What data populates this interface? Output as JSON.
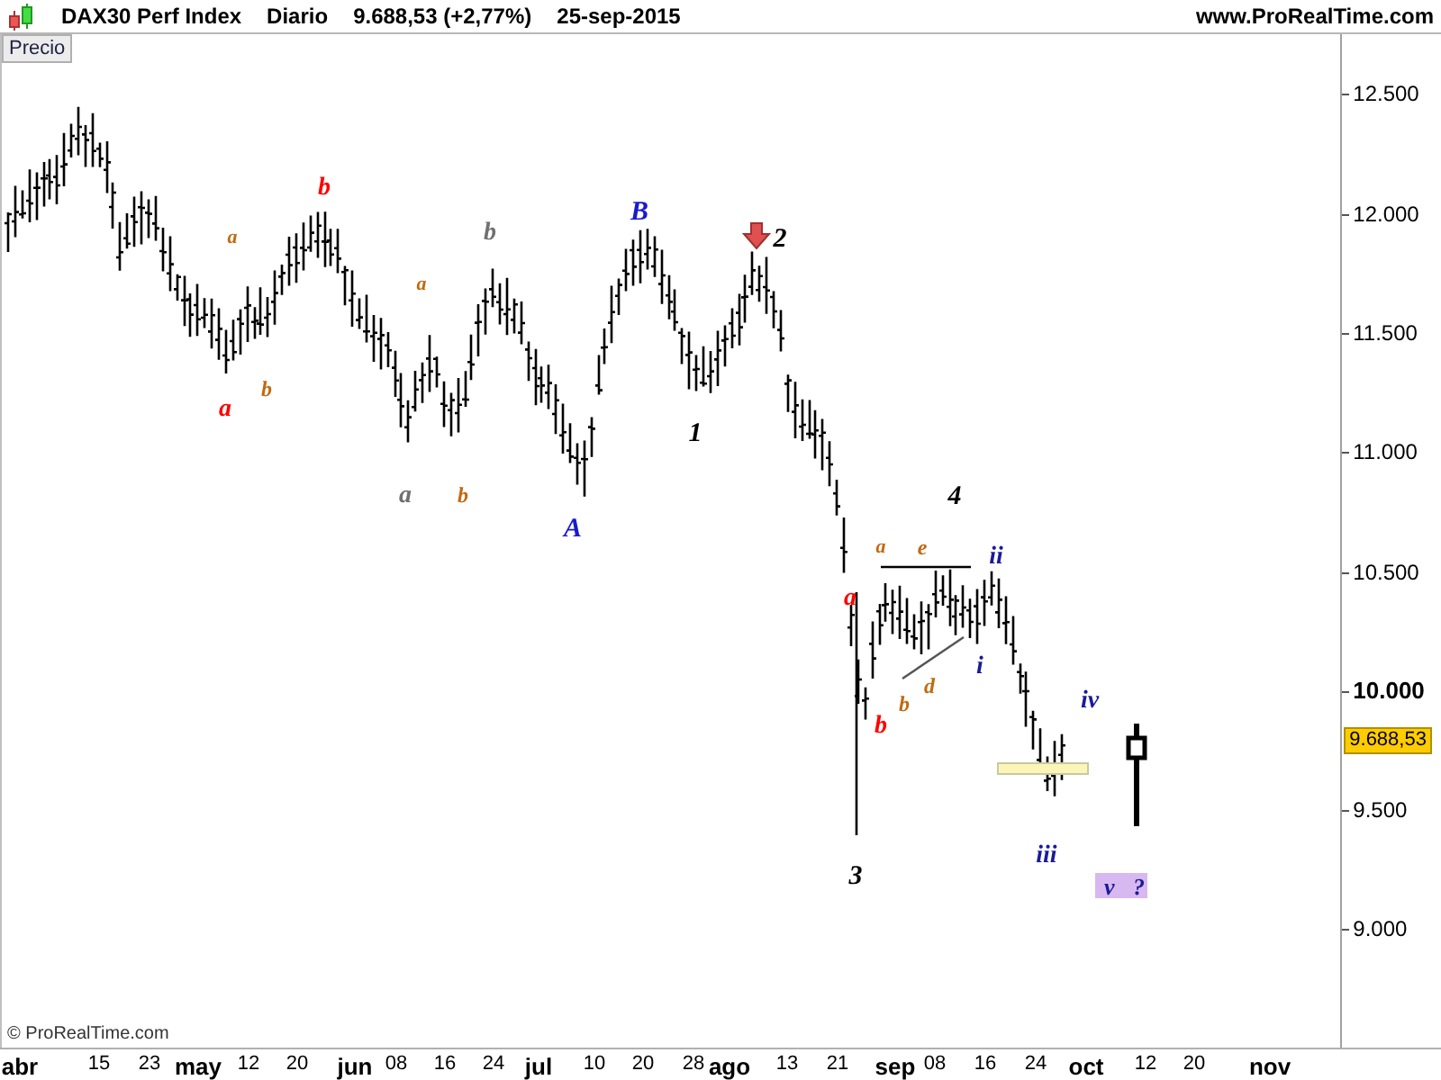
{
  "header": {
    "title": "DAX30 Perf Index",
    "period": "Diario",
    "price": "9.688,53 (+2,77%)",
    "date": "25-sep-2015",
    "website": "www.ProRealTime.com"
  },
  "panel_tab": "Precio",
  "chart": {
    "wave_labels": [
      {
        "text": "a",
        "color": "#c06a10"
      },
      {
        "text": "a",
        "color": "#ff0000"
      },
      {
        "text": "b",
        "color": "#c06a10"
      },
      {
        "text": "b",
        "color": "#ff0000"
      },
      {
        "text": "a",
        "color": "#c06a10"
      },
      {
        "text": "b",
        "color": "#707070"
      },
      {
        "text": "a",
        "color": "#707070"
      },
      {
        "text": "b",
        "color": "#c06a10"
      },
      {
        "text": "A",
        "color": "#1a1acc"
      },
      {
        "text": "B",
        "color": "#1a1acc"
      },
      {
        "text": "1",
        "color": "#000000"
      },
      {
        "text": "2",
        "color": "#000000"
      },
      {
        "text": "3",
        "color": "#000000"
      },
      {
        "text": "4",
        "color": "#000000"
      },
      {
        "text": "a",
        "color": "#ff0000"
      },
      {
        "text": "b",
        "color": "#ff0000"
      },
      {
        "text": "a",
        "color": "#c06a10"
      },
      {
        "text": "e",
        "color": "#c06a10"
      },
      {
        "text": "b",
        "color": "#c06a10"
      },
      {
        "text": "d",
        "color": "#c06a10"
      },
      {
        "text": "i",
        "color": "#1a1a99"
      },
      {
        "text": "ii",
        "color": "#1a1a99"
      },
      {
        "text": "iii",
        "color": "#1a1a99"
      },
      {
        "text": "iv",
        "color": "#1a1a99"
      }
    ],
    "projection": [
      "v",
      "?"
    ],
    "last_price": "9.688,53",
    "y_axis": [
      {
        "text": "12.500",
        "major": false
      },
      {
        "text": "12.000",
        "major": false
      },
      {
        "text": "11.500",
        "major": false
      },
      {
        "text": "11.000",
        "major": false
      },
      {
        "text": "10.500",
        "major": false
      },
      {
        "text": "10.000",
        "major": true
      },
      {
        "text": "9.500",
        "major": false
      },
      {
        "text": "9.000",
        "major": false
      }
    ],
    "x_axis": [
      {
        "text": "abr",
        "major": true
      },
      {
        "text": "15",
        "major": false
      },
      {
        "text": "23",
        "major": false
      },
      {
        "text": "may",
        "major": true
      },
      {
        "text": "12",
        "major": false
      },
      {
        "text": "20",
        "major": false
      },
      {
        "text": "jun",
        "major": true
      },
      {
        "text": "08",
        "major": false
      },
      {
        "text": "16",
        "major": false
      },
      {
        "text": "24",
        "major": false
      },
      {
        "text": "jul",
        "major": true
      },
      {
        "text": "10",
        "major": false
      },
      {
        "text": "20",
        "major": false
      },
      {
        "text": "28",
        "major": false
      },
      {
        "text": "ago",
        "major": true
      },
      {
        "text": "13",
        "major": false
      },
      {
        "text": "21",
        "major": false
      },
      {
        "text": "sep",
        "major": true
      },
      {
        "text": "08",
        "major": false
      },
      {
        "text": "16",
        "major": false
      },
      {
        "text": "24",
        "major": false
      },
      {
        "text": "oct",
        "major": true
      },
      {
        "text": "12",
        "major": false
      },
      {
        "text": "20",
        "major": false
      },
      {
        "text": "nov",
        "major": true
      }
    ],
    "copyright": "© ProRealTime.com"
  }
}
